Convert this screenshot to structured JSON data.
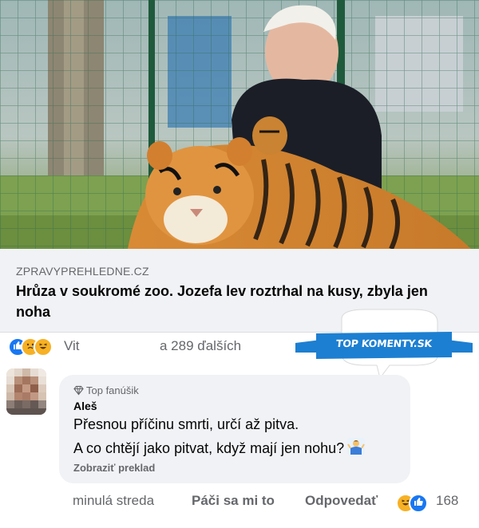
{
  "post": {
    "image_alt": "man with tiger in zoo enclosure",
    "link_domain": "ZPRAVYPREHLEDNE.CZ",
    "link_title": "Hrůza v soukromé zoo. Jozefa lev roztrhal na kusy, zbyla jen noha"
  },
  "reactions": {
    "icons": [
      "like-icon",
      "sad-icon",
      "haha-icon"
    ],
    "name": "Vit",
    "others": "a 289 ďalších"
  },
  "badge": {
    "text": "TOP KOMENTY.SK",
    "color": "#1d7fd1"
  },
  "comment": {
    "badge_label": "Top fanúšik",
    "author": "Aleš",
    "text_line1": "Přesnou příčinu smrti, určí až pitva.",
    "text_line2": "A co chtějí jako pitvat, když mají jen nohu?",
    "translate": "Zobraziť preklad",
    "time": "minulá streda",
    "like": "Páči sa mi to",
    "reply": "Odpovedať",
    "reaction_count": "168"
  },
  "colors": {
    "accent": "#1877f2",
    "secondary_text": "#65676b",
    "bubble": "#f0f2f5"
  }
}
